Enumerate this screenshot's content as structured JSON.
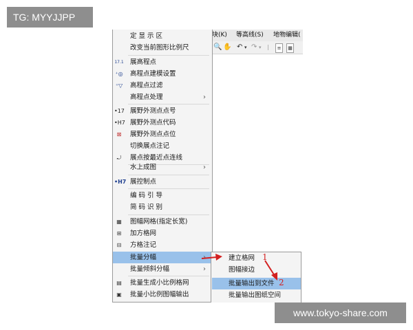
{
  "watermark_tl": "TG: MYYJJPP",
  "watermark_br": "www.tokyo-share.com",
  "menubar": {
    "items": [
      "块(K)",
      "等高线(S)",
      "地物编辑("
    ]
  },
  "menu": {
    "items": [
      {
        "label": "定 显 示 区"
      },
      {
        "label": "改变当前图形比例尺"
      },
      {
        "label": "展高程点",
        "icon": "17.1"
      },
      {
        "label": "高程点建模设置"
      },
      {
        "label": "高程点过滤"
      },
      {
        "label": "高程点处理",
        "submenu": "›"
      },
      {
        "label": "展野外测点点号",
        "icon": "•17"
      },
      {
        "label": "展野外测点代码",
        "icon": "•H7"
      },
      {
        "label": "展野外测点点位"
      },
      {
        "label": "切换展点注记"
      },
      {
        "label": "展点按最近点连线"
      },
      {
        "label": "水上成图",
        "submenu": "›"
      },
      {
        "label": "展控制点",
        "icon": "•H7"
      },
      {
        "label": "编 码 引 导"
      },
      {
        "label": "简 码 识 别"
      },
      {
        "label": "图幅网格(指定长宽)"
      },
      {
        "label": "加方格网"
      },
      {
        "label": "方格注记"
      },
      {
        "label": "批量分幅",
        "submenu": "›"
      },
      {
        "label": "批量倾斜分幅",
        "submenu": "›"
      },
      {
        "label": "批量生成小比例格网"
      },
      {
        "label": "批量小比例图幅输出"
      }
    ]
  },
  "submenu": {
    "items": [
      {
        "label": "建立格网"
      },
      {
        "label": "图幅接边"
      },
      {
        "label": "批量输出到文件"
      },
      {
        "label": "批量输出图纸空间"
      }
    ]
  },
  "annotations": {
    "one": "1",
    "two": "2"
  },
  "colors": {
    "highlight": "#99c1ea",
    "arrow": "#d32020"
  }
}
